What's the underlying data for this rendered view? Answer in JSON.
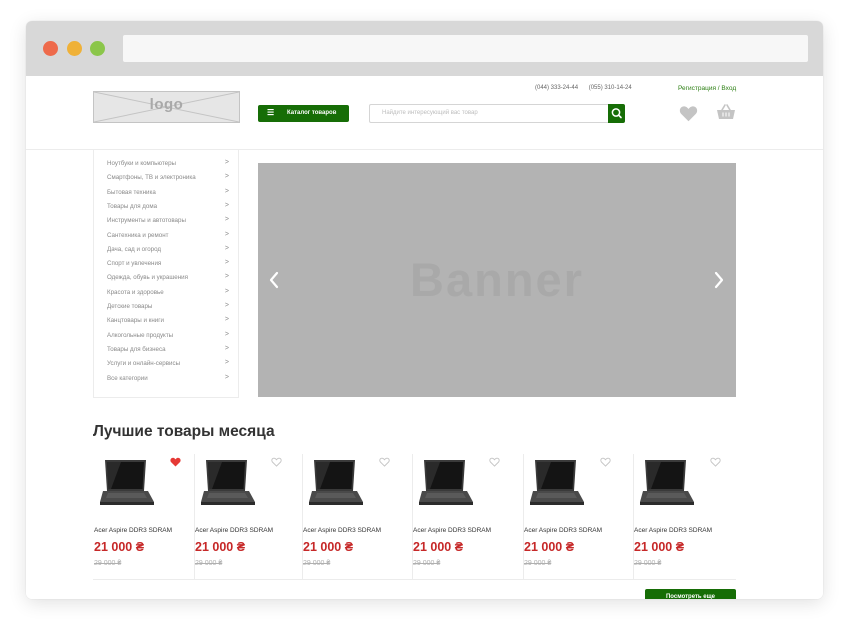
{
  "header": {
    "logo_text": "logo",
    "phones": [
      "(044) 333-24-44",
      "(055) 310-14-24"
    ],
    "auth_link": "Регистрация / Вход",
    "catalog_button": "Каталог товаров",
    "catalog_icon": "list-icon",
    "search_placeholder": "Найдите интересующий вас товар",
    "search_icon": "search-icon",
    "favorites_icon": "heart-icon",
    "cart_icon": "basket-icon"
  },
  "sidebar": {
    "categories": [
      "Ноутбуки и компьютеры",
      "Смартфоны, ТВ и электроника",
      "Бытовая техника",
      "Товары для дома",
      "Инструменты и автотовары",
      "Сантехника и ремонт",
      "Дача, сад и огород",
      "Спорт и увлечения",
      "Одежда, обувь и украшения",
      "Красота и здоровье",
      "Детские товары",
      "Канцтовары и книги",
      "Алкогольные продукты",
      "Товары для бизнеса",
      "Услуги и онлайн-сервисы",
      "Все категории"
    ],
    "arrow": ">"
  },
  "banner": {
    "text": "Banner",
    "prev_icon": "chevron-left-icon",
    "next_icon": "chevron-right-icon"
  },
  "products_section": {
    "title": "Лучшие товары месяца",
    "more_button": "Посмотреть еще",
    "products": [
      {
        "name": "Acer Aspire DDR3 SDRAM",
        "price": "21 000 ₴",
        "old_price": "29 000 ₴",
        "favorite": true
      },
      {
        "name": "Acer Aspire DDR3 SDRAM",
        "price": "21 000 ₴",
        "old_price": "29 000 ₴",
        "favorite": false
      },
      {
        "name": "Acer Aspire DDR3 SDRAM",
        "price": "21 000 ₴",
        "old_price": "29 000 ₴",
        "favorite": false
      },
      {
        "name": "Acer Aspire DDR3 SDRAM",
        "price": "21 000 ₴",
        "old_price": "29 000 ₴",
        "favorite": false
      },
      {
        "name": "Acer Aspire DDR3 SDRAM",
        "price": "21 000 ₴",
        "old_price": "29 000 ₴",
        "favorite": false
      },
      {
        "name": "Acer Aspire DDR3 SDRAM",
        "price": "21 000 ₴",
        "old_price": "29 000 ₴",
        "favorite": false
      }
    ]
  },
  "colors": {
    "accent_green": "#166d06",
    "price_red": "#c62828",
    "favorite_active": "#e53935"
  }
}
